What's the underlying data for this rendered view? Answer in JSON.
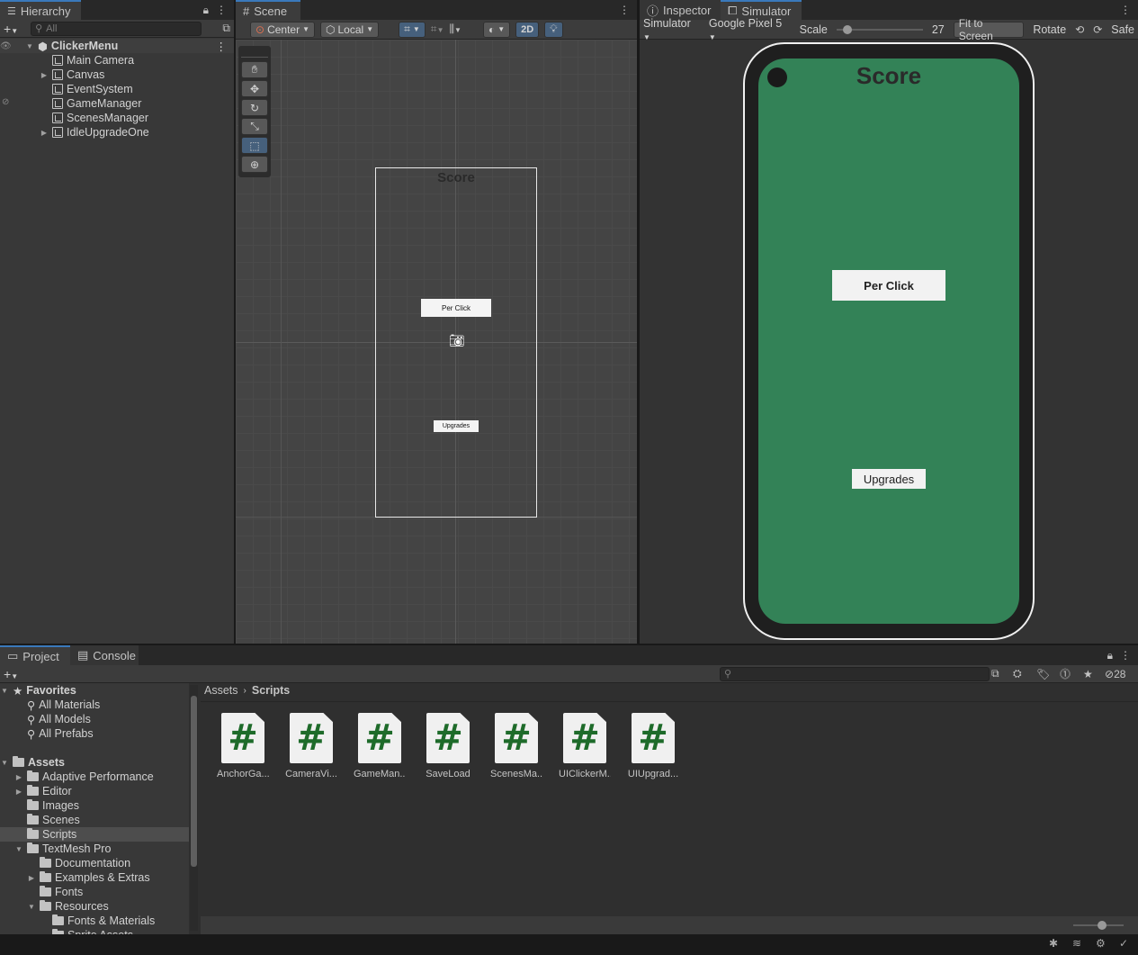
{
  "hierarchy": {
    "tab": "Hierarchy",
    "search_placeholder": "All",
    "scene": "ClickerMenu",
    "items": [
      {
        "label": "Main Camera",
        "expandable": false
      },
      {
        "label": "Canvas",
        "expandable": true
      },
      {
        "label": "EventSystem",
        "expandable": false
      },
      {
        "label": "GameManager",
        "expandable": false
      },
      {
        "label": "ScenesManager",
        "expandable": false
      },
      {
        "label": "IdleUpgradeOne",
        "expandable": true
      }
    ]
  },
  "scene_view": {
    "tab": "Scene",
    "pivot": "Center",
    "space": "Local",
    "mode_2d": "2D",
    "canvas_score": "Score",
    "canvas_per_click": "Per Click",
    "canvas_upgrades": "Upgrades"
  },
  "right_panel": {
    "tab_inspector": "Inspector",
    "tab_simulator": "Simulator",
    "sim_mode": "Simulator",
    "device": "Google Pixel 5",
    "scale_label": "Scale",
    "scale_value": "27",
    "scale_fraction": 0.08,
    "fit_label": "Fit to Screen",
    "rotate_label": "Rotate",
    "safe_label": "Safe",
    "phone_score": "Score",
    "phone_per_click": "Per Click",
    "phone_upgrades": "Upgrades",
    "screen_color": "#338257"
  },
  "project": {
    "tab_project": "Project",
    "tab_console": "Console",
    "hidden_count": "28",
    "breadcrumb_root": "Assets",
    "breadcrumb_current": "Scripts",
    "favorites_label": "Favorites",
    "favorites": [
      "All Materials",
      "All Models",
      "All Prefabs"
    ],
    "assets_label": "Assets",
    "tree": [
      {
        "label": "Adaptive Performance",
        "indent": 1,
        "expandable": true,
        "expanded": false,
        "selected": false
      },
      {
        "label": "Editor",
        "indent": 1,
        "expandable": true,
        "expanded": false,
        "selected": false
      },
      {
        "label": "Images",
        "indent": 1,
        "expandable": false,
        "expanded": false,
        "selected": false
      },
      {
        "label": "Scenes",
        "indent": 1,
        "expandable": false,
        "expanded": false,
        "selected": false
      },
      {
        "label": "Scripts",
        "indent": 1,
        "expandable": false,
        "expanded": false,
        "selected": true
      },
      {
        "label": "TextMesh Pro",
        "indent": 1,
        "expandable": true,
        "expanded": true,
        "selected": false
      },
      {
        "label": "Documentation",
        "indent": 2,
        "expandable": false,
        "expanded": false,
        "selected": false
      },
      {
        "label": "Examples & Extras",
        "indent": 2,
        "expandable": true,
        "expanded": false,
        "selected": false
      },
      {
        "label": "Fonts",
        "indent": 2,
        "expandable": false,
        "expanded": false,
        "selected": false
      },
      {
        "label": "Resources",
        "indent": 2,
        "expandable": true,
        "expanded": true,
        "selected": false
      },
      {
        "label": "Fonts & Materials",
        "indent": 3,
        "expandable": false,
        "expanded": false,
        "selected": false
      },
      {
        "label": "Sprite Assets",
        "indent": 3,
        "expandable": false,
        "expanded": false,
        "selected": false
      }
    ],
    "assets": [
      "AnchorGa...",
      "CameraVi...",
      "GameMan...",
      "SaveLoad",
      "ScenesMa...",
      "UIClickerM...",
      "UIUpgrad..."
    ],
    "asset_glyph": "#"
  }
}
